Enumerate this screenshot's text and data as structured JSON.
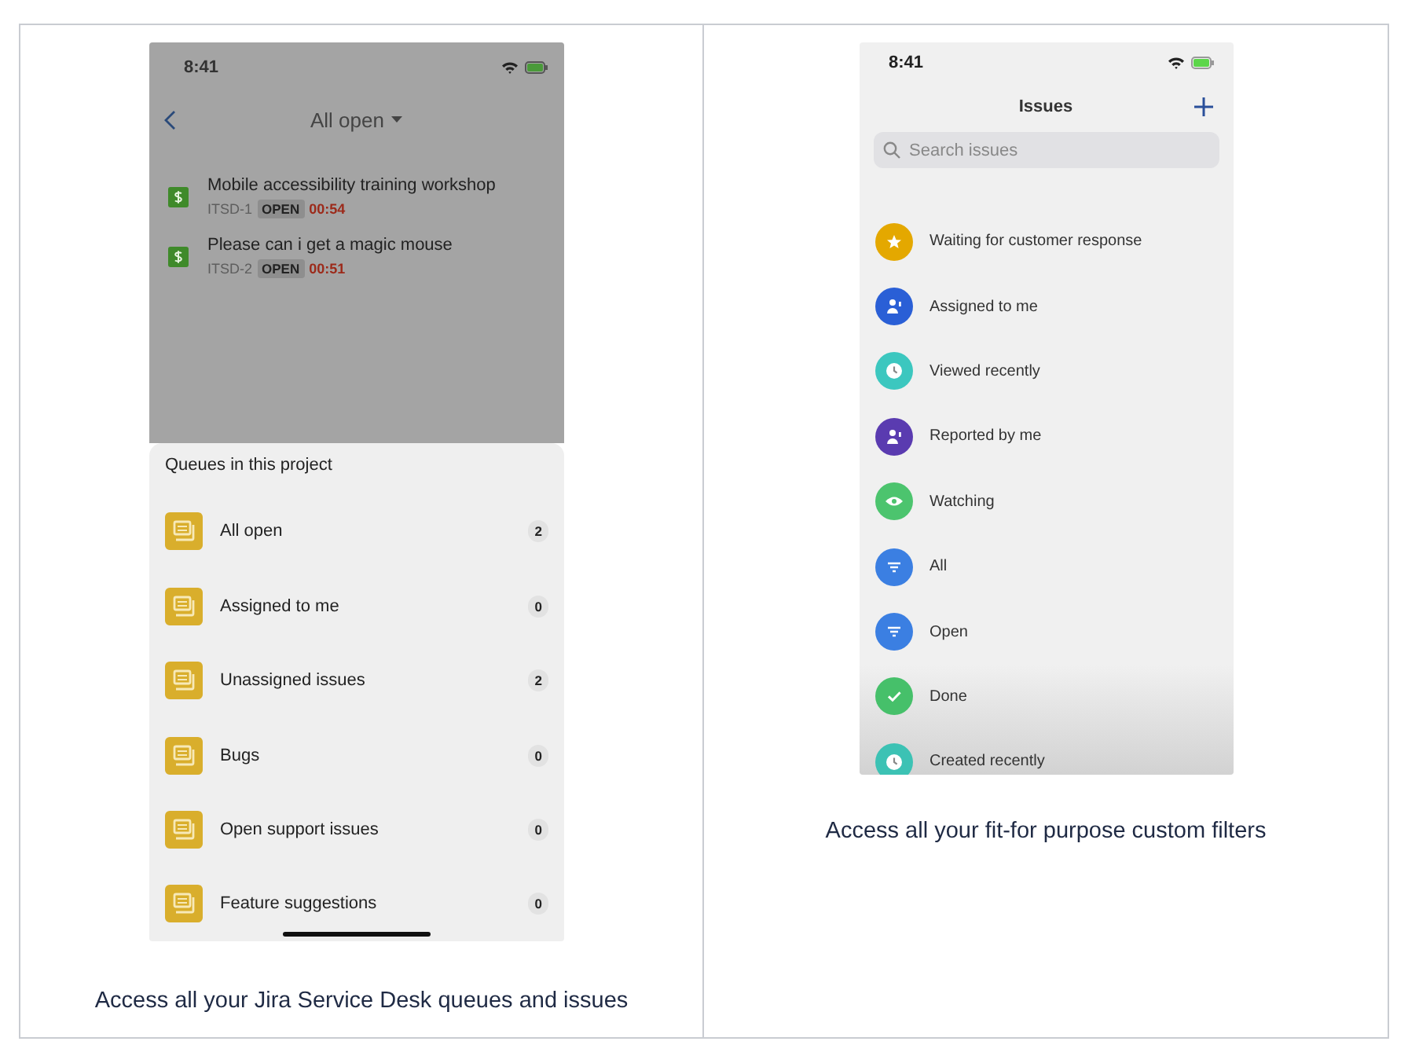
{
  "left_panel": {
    "status_bar": {
      "time": "8:41"
    },
    "nav": {
      "title": "All open"
    },
    "issues": [
      {
        "title": "Mobile accessibility training workshop",
        "key": "ITSD-1",
        "status": "OPEN",
        "timer": "00:54"
      },
      {
        "title": "Please can i get a magic mouse",
        "key": "ITSD-2",
        "status": "OPEN",
        "timer": "00:51"
      }
    ],
    "sheet": {
      "title": "Queues in this project",
      "queues": [
        {
          "name": "All open",
          "count": "2"
        },
        {
          "name": "Assigned to me",
          "count": "0"
        },
        {
          "name": "Unassigned issues",
          "count": "2"
        },
        {
          "name": "Bugs",
          "count": "0"
        },
        {
          "name": "Open support issues",
          "count": "0"
        },
        {
          "name": "Feature suggestions",
          "count": "0"
        }
      ]
    },
    "caption": "Access all your Jira Service Desk queues and issues"
  },
  "right_panel": {
    "status_bar": {
      "time": "8:41"
    },
    "nav": {
      "title": "Issues"
    },
    "search": {
      "placeholder": "Search issues"
    },
    "filters": [
      {
        "name": "Waiting for customer response",
        "kind": "star",
        "color": "#e4a800"
      },
      {
        "name": "Assigned to me",
        "kind": "person",
        "color": "#2a5fd6"
      },
      {
        "name": "Viewed recently",
        "kind": "clock",
        "color": "#3cc7bf"
      },
      {
        "name": "Reported by me",
        "kind": "person",
        "color": "#5a3bb0"
      },
      {
        "name": "Watching",
        "kind": "eye",
        "color": "#4cc46e"
      },
      {
        "name": "All",
        "kind": "filter",
        "color": "#3b7fe2"
      },
      {
        "name": "Open",
        "kind": "filter",
        "color": "#3b7fe2"
      },
      {
        "name": "Done",
        "kind": "check",
        "color": "#46c06a"
      },
      {
        "name": "Created recently",
        "kind": "clock",
        "color": "#3cc2b4"
      }
    ],
    "caption": "Access all your fit-for purpose custom filters"
  }
}
